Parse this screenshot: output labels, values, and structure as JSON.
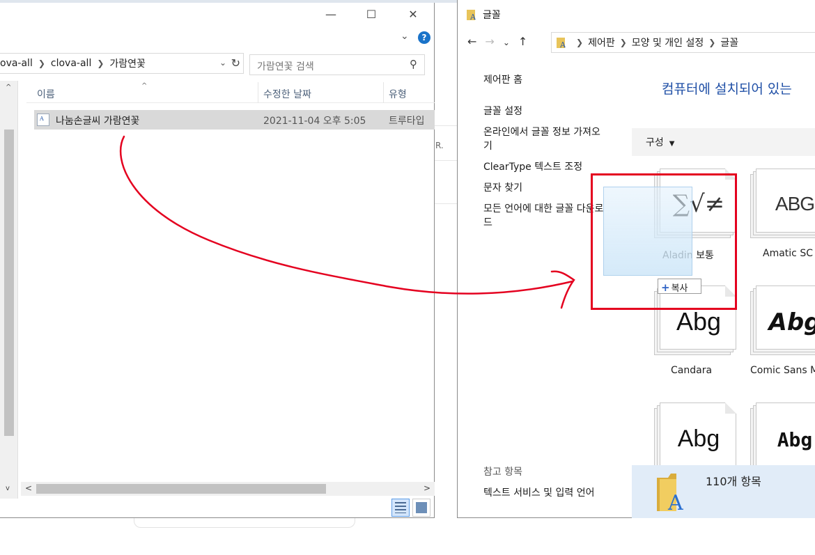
{
  "explorer": {
    "breadcrumbs": [
      "ova-all",
      "clova-all",
      "가람연꽃"
    ],
    "search_placeholder": "가람연꽃 검색",
    "columns": [
      "이름",
      "수정한 날짜",
      "유형"
    ],
    "files": [
      {
        "name": "나눔손글씨 가람연꽃",
        "date": "2021-11-04 오후 5:05",
        "type": "트루타입"
      }
    ],
    "window_controls": {
      "minimize": "—",
      "maximize": "☐",
      "close": "✕"
    },
    "help_label": "?",
    "icons": {
      "file": "font-file-icon",
      "refresh": "refresh-icon",
      "search": "search-icon"
    }
  },
  "control_panel": {
    "window_title": "글꼴",
    "address": [
      "제어판",
      "모양 및 개인 설정",
      "글꼴"
    ],
    "sidebar_links": [
      "제어판 홈",
      "글꼴 설정",
      "온라인에서 글꼴 정보 가져오\n기",
      "ClearType 텍스트 조정",
      "문자 찾기",
      "모든 언어에 대한 글꼴 다운로\n드"
    ],
    "see_also_heading": "참고 항목",
    "see_also_links": [
      "텍스트 서비스 및 입력 언어"
    ],
    "heading": "컴퓨터에 설치되어 있는",
    "organize_label": "구성",
    "fonts": [
      {
        "name": "Aladin 보통",
        "glyph": "∑√≠"
      },
      {
        "name": "Amatic SC",
        "glyph": "ABG"
      },
      {
        "name": "Candara",
        "glyph": "Abg"
      },
      {
        "name": "Comic Sans M",
        "glyph": "Abg"
      },
      {
        "name": "",
        "glyph": "Abg"
      },
      {
        "name": "",
        "glyph": "Abg"
      }
    ],
    "footer_count": "110개 항목",
    "icons": {
      "folder": "font-folder-icon"
    }
  },
  "drag": {
    "copy_label": "복사",
    "arrow_color": "#e4001f",
    "highlight_color": "#e4001f"
  },
  "background": {
    "ghost_text": "R."
  }
}
